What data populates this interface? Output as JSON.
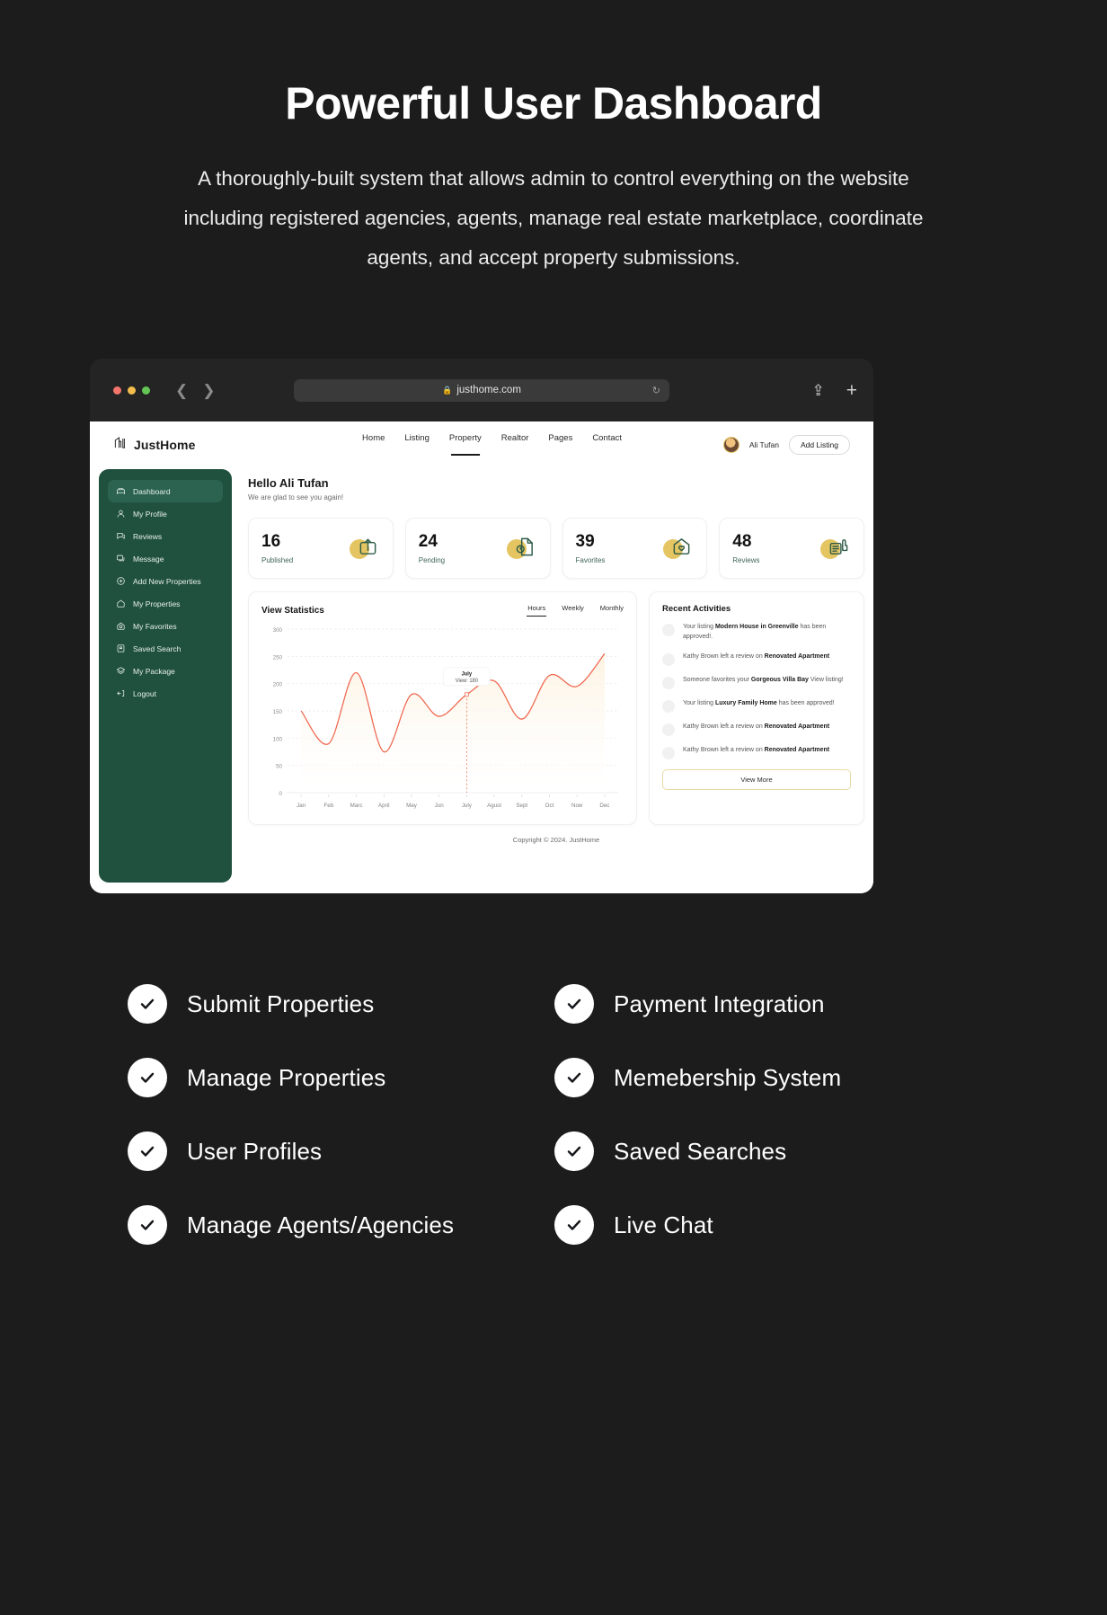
{
  "hero": {
    "title": "Powerful User Dashboard",
    "subtitle": "A thoroughly-built system that allows admin to control everything on the website including registered agencies, agents, manage real estate marketplace, coordinate agents, and accept property submissions."
  },
  "browser": {
    "url": "justhome.com",
    "lock_icon": "lock-icon",
    "reload_icon": "reload-icon",
    "back_icon": "chevron-left-icon",
    "forward_icon": "chevron-right-icon",
    "share_icon": "share-icon",
    "newtab_icon": "plus-icon"
  },
  "site_header": {
    "brand": "JustHome",
    "brand_icon": "building-logo-icon",
    "nav": [
      {
        "label": "Home",
        "active": false
      },
      {
        "label": "Listing",
        "active": false
      },
      {
        "label": "Property",
        "active": true
      },
      {
        "label": "Realtor",
        "active": false
      },
      {
        "label": "Pages",
        "active": false
      },
      {
        "label": "Contact",
        "active": false
      }
    ],
    "user_name": "Ali Tufan",
    "avatar_icon": "avatar",
    "add_listing": "Add Listing"
  },
  "sidebar": {
    "items": [
      {
        "label": "Dashboard",
        "icon": "dashboard-icon",
        "active": true
      },
      {
        "label": "My Profile",
        "icon": "user-icon",
        "active": false
      },
      {
        "label": "Reviews",
        "icon": "review-icon",
        "active": false
      },
      {
        "label": "Message",
        "icon": "message-icon",
        "active": false
      },
      {
        "label": "Add New Properties",
        "icon": "plus-circle-icon",
        "active": false
      },
      {
        "label": "My Properties",
        "icon": "home-icon",
        "active": false
      },
      {
        "label": "My Favorites",
        "icon": "heart-home-icon",
        "active": false
      },
      {
        "label": "Saved Search",
        "icon": "saved-search-icon",
        "active": false
      },
      {
        "label": "My Package",
        "icon": "layers-icon",
        "active": false
      },
      {
        "label": "Logout",
        "icon": "logout-icon",
        "active": false
      }
    ]
  },
  "greeting": {
    "title": "Hello Ali Tufan",
    "subtitle": "We are glad to see you again!"
  },
  "stats": [
    {
      "value": "16",
      "label": "Published",
      "icon": "publish-box-icon"
    },
    {
      "value": "24",
      "label": "Pending",
      "icon": "pending-doc-icon"
    },
    {
      "value": "39",
      "label": "Favorites",
      "icon": "favorite-home-icon"
    },
    {
      "value": "48",
      "label": "Reviews",
      "icon": "review-thumb-icon"
    }
  ],
  "chart_panel": {
    "title": "View Statistics",
    "tabs": [
      {
        "label": "Hours",
        "active": true
      },
      {
        "label": "Weekly",
        "active": false
      },
      {
        "label": "Monthly",
        "active": false
      }
    ]
  },
  "chart_data": {
    "type": "area",
    "title": "View Statistics",
    "xlabel": "",
    "ylabel": "",
    "ylim": [
      0,
      300
    ],
    "yticks": [
      0,
      50,
      100,
      150,
      200,
      250,
      300
    ],
    "grid": true,
    "legend": "none",
    "line_color": "#f0674f",
    "fill_color": "#fdf3e2",
    "categories": [
      "Jan",
      "Feb",
      "Marc",
      "April",
      "May",
      "Jun",
      "July",
      "Agust",
      "Sept",
      "Oct",
      "Now",
      "Dec"
    ],
    "series": [
      {
        "name": "Views",
        "values": [
          150,
          90,
          220,
          75,
          180,
          140,
          180,
          205,
          135,
          215,
          195,
          255
        ]
      }
    ],
    "tooltip": {
      "label": "July",
      "value_text": "View: 180",
      "x_category": "July",
      "y_value": 180
    }
  },
  "activities": {
    "title": "Recent Activities",
    "items": [
      {
        "prefix": "Your listing ",
        "bold": "Modern House in Greenville",
        "suffix": " has been approved!."
      },
      {
        "prefix": "Kathy Brown left a review on ",
        "bold": "Renovated Apartment",
        "suffix": ""
      },
      {
        "prefix": "Someone favorites your ",
        "bold": "Gorgeous Villa Bay",
        "suffix": " View listing!"
      },
      {
        "prefix": "Your listing ",
        "bold": "Luxury Family Home",
        "suffix": " has been approved!"
      },
      {
        "prefix": "Kathy Brown left a review on ",
        "bold": "Renovated Apartment",
        "suffix": ""
      },
      {
        "prefix": "Kathy Brown left a review on ",
        "bold": "Renovated Apartment",
        "suffix": ""
      }
    ],
    "view_more": "View More"
  },
  "footer": {
    "copyright": "Copyright © 2024. JustHome"
  },
  "features": [
    {
      "label": "Submit Properties",
      "icon": "check-circle-icon"
    },
    {
      "label": "Payment Integration",
      "icon": "check-circle-icon"
    },
    {
      "label": "Manage Properties",
      "icon": "check-circle-icon"
    },
    {
      "label": "Memebership System",
      "icon": "check-circle-icon"
    },
    {
      "label": "User Profiles",
      "icon": "check-circle-icon"
    },
    {
      "label": "Saved Searches",
      "icon": "check-circle-icon"
    },
    {
      "label": "Manage Agents/Agencies",
      "icon": "check-circle-icon"
    },
    {
      "label": "Live Chat",
      "icon": "check-circle-icon"
    }
  ],
  "colors": {
    "background": "#1c1c1c",
    "sidebar": "#20513f",
    "accent_gold": "#e4c562",
    "chart_line": "#f0674f",
    "text_light": "#ffffff"
  }
}
